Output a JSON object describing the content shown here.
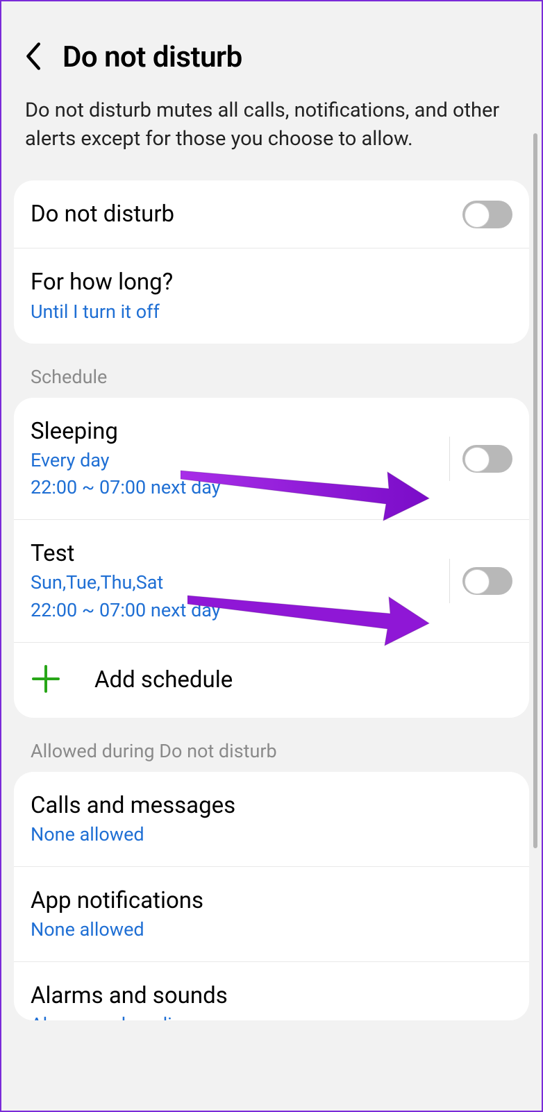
{
  "header": {
    "title": "Do not disturb",
    "description": "Do not disturb mutes all calls, notifications, and other alerts except for those you choose to allow."
  },
  "main_toggle": {
    "label": "Do not disturb",
    "state": "off"
  },
  "duration": {
    "label": "For how long?",
    "value": "Until I turn it off"
  },
  "schedule": {
    "header": "Schedule",
    "items": [
      {
        "name": "Sleeping",
        "days": "Every day",
        "time": "22:00 ~ 07:00 next day",
        "state": "off"
      },
      {
        "name": "Test",
        "days": "Sun,Tue,Thu,Sat",
        "time": "22:00 ~ 07:00 next day",
        "state": "off"
      }
    ],
    "add_label": "Add schedule"
  },
  "allowed": {
    "header": "Allowed during Do not disturb",
    "items": [
      {
        "title": "Calls and messages",
        "sub": "None allowed"
      },
      {
        "title": "App notifications",
        "sub": "None allowed"
      },
      {
        "title": "Alarms and sounds",
        "sub": "Alarms and media"
      }
    ]
  },
  "annotations": {
    "arrow_color": "#8a12d6"
  }
}
